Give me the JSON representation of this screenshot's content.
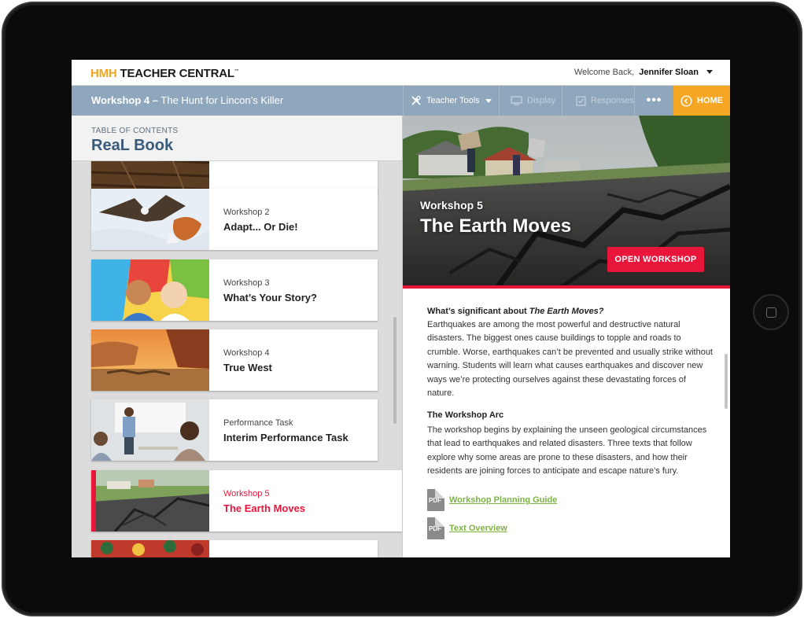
{
  "header": {
    "logo_hmh": "HMH",
    "logo_tc": "TEACHER CENTRAL",
    "welcome_label": "Welcome Back,",
    "user_name": "Jennifer Sloan"
  },
  "toolbar": {
    "workshop_label": "Workshop 4 –",
    "workshop_title": "The Hunt for Lincon’s Killer",
    "teacher_tools": "Teacher Tools",
    "display": "Display",
    "responses": "Responses",
    "more": "•••",
    "home": "HOME"
  },
  "toc": {
    "small_label": "TABLE OF CONTENTS",
    "book_title": "ReaL Book",
    "items": [
      {
        "subtitle": "Workshop 2",
        "title": "Adapt... Or Die!"
      },
      {
        "subtitle": "Workshop 3",
        "title": "What’s Your Story?"
      },
      {
        "subtitle": "Workshop 4",
        "title": "True West"
      },
      {
        "subtitle": "Performance Task",
        "title": "Interim Performance Task"
      },
      {
        "subtitle": "Workshop 5",
        "title": "The Earth Moves"
      }
    ]
  },
  "hero": {
    "subtitle": "Workshop 5",
    "title": "The Earth Moves",
    "open_button": "OPEN WORKSHOP"
  },
  "detail": {
    "sig_heading_prefix": "What’s significant about",
    "sig_heading_title": "The Earth Moves?",
    "sig_paragraph": "Earthquakes are among the most powerful and destructive natural disasters. The biggest ones cause buildings to topple and roads to crumble. Worse, earthquakes can’t be prevented and usually strike without warning. Students will learn what causes earthquakes and discover new ways we’re protecting ourselves against these devastating forces of nature.",
    "arc_heading": "The Workshop Arc",
    "arc_paragraph": "The workshop begins by explaining the unseen geological circumstances that lead to earthquakes and related disasters. Three texts that follow explore why some areas are prone to these disasters, and how their residents are joining forces to anticipate and escape nature’s fury.",
    "documents": [
      {
        "type": "PDF",
        "label": "Workshop Planning Guide"
      },
      {
        "type": "PDF",
        "label": "Text Overview"
      }
    ]
  },
  "colors": {
    "accent_red": "#e8163b",
    "toolbar_blue": "#8fa7bd",
    "home_orange": "#f5a623",
    "link_green": "#7cb342",
    "title_blue": "#3a5a7a"
  }
}
